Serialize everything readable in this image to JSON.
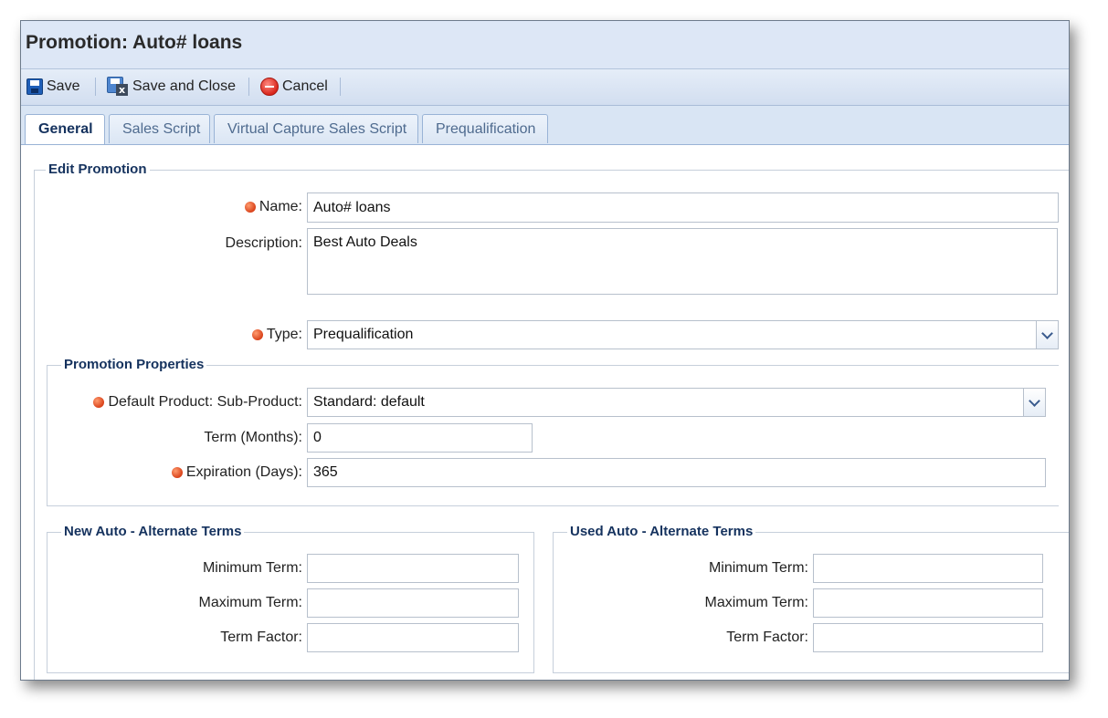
{
  "title": "Promotion: Auto# loans",
  "toolbar": {
    "save_label": "Save",
    "save_close_label": "Save and Close",
    "cancel_label": "Cancel"
  },
  "tabs": [
    {
      "label": "General",
      "active": true
    },
    {
      "label": "Sales Script",
      "active": false
    },
    {
      "label": "Virtual Capture Sales Script",
      "active": false
    },
    {
      "label": "Prequalification",
      "active": false
    }
  ],
  "edit_promotion": {
    "legend": "Edit Promotion",
    "name_label": "Name:",
    "name_value": "Auto# loans",
    "description_label": "Description:",
    "description_value": "Best Auto Deals",
    "type_label": "Type:",
    "type_value": "Prequalification"
  },
  "promotion_properties": {
    "legend": "Promotion Properties",
    "default_product_label": "Default Product: Sub-Product:",
    "default_product_value": "Standard: default",
    "term_label": "Term (Months):",
    "term_value": "0",
    "expiration_label": "Expiration (Days):",
    "expiration_value": "365"
  },
  "new_auto": {
    "legend": "New Auto - Alternate Terms",
    "min_label": "Minimum Term:",
    "min_value": "",
    "max_label": "Maximum Term:",
    "max_value": "",
    "factor_label": "Term Factor:",
    "factor_value": ""
  },
  "used_auto": {
    "legend": "Used Auto - Alternate Terms",
    "min_label": "Minimum Term:",
    "min_value": "",
    "max_label": "Maximum Term:",
    "max_value": "",
    "factor_label": "Term Factor:",
    "factor_value": ""
  },
  "colors": {
    "titlebar_bg": "#dde7f6",
    "legend_text": "#15325e",
    "required_dot": "#d9421a",
    "inactive_tab_text": "#4f6b8f"
  },
  "icons": {
    "save": "floppy-disk-icon",
    "save_close": "floppy-disk-close-icon",
    "cancel": "cancel-circle-icon",
    "required": "required-dot-icon",
    "dropdown": "chevron-down-icon"
  }
}
